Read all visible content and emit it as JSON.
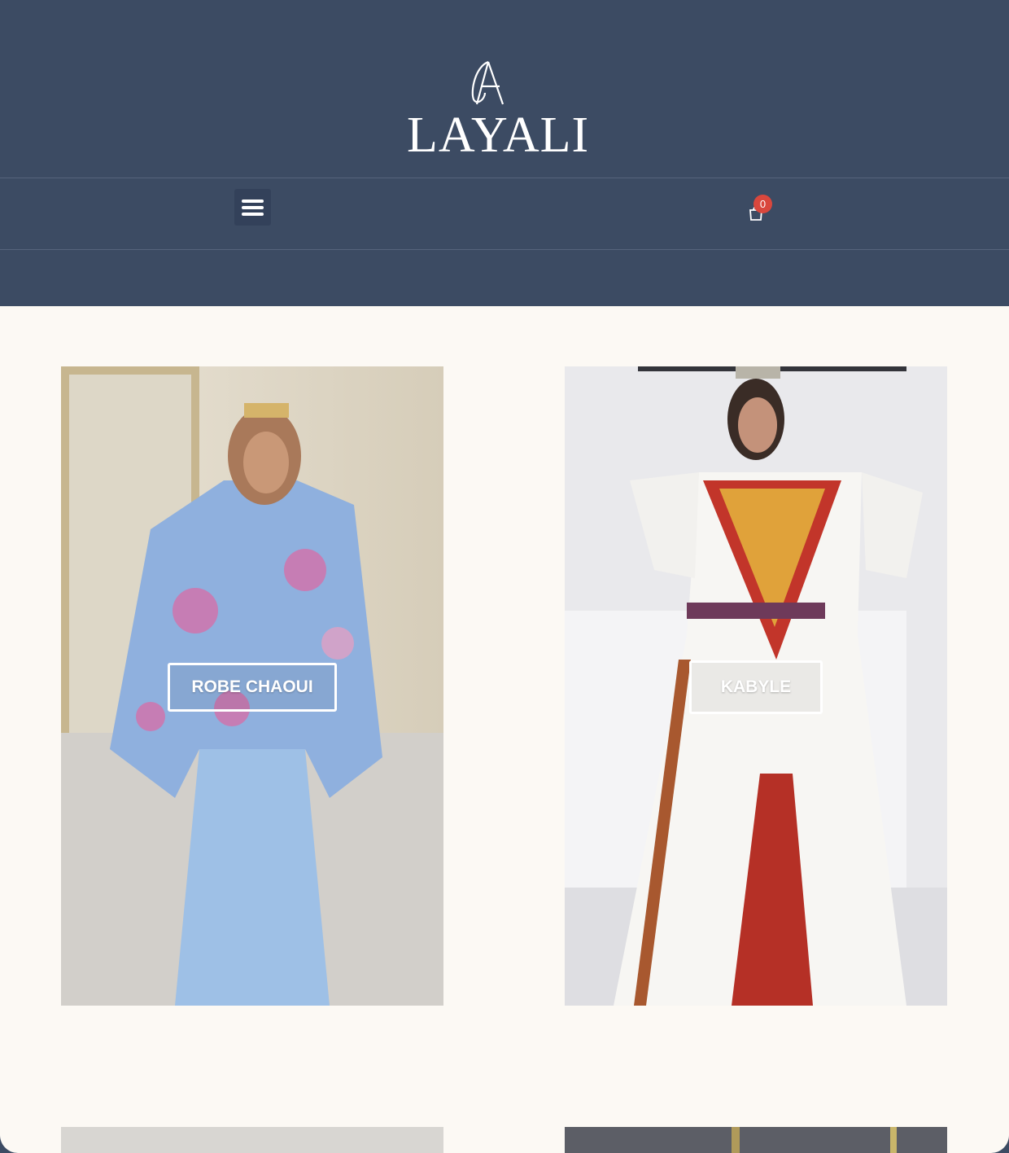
{
  "brand": {
    "name": "LAYALI",
    "colors": {
      "header_bg": "#3c4b63",
      "page_bg": "#fcf9f4",
      "badge": "#d9473d"
    }
  },
  "nav": {
    "menu_icon": "hamburger-menu-icon",
    "cart_icon": "shopping-bag-icon",
    "cart_count": "0"
  },
  "categories": [
    {
      "label": "ROBE CHAOUI",
      "image": "woman-in-blue-floral-cape-dress"
    },
    {
      "label": "KABYLE",
      "image": "woman-in-white-kabyle-dress"
    }
  ],
  "more_categories": [
    {
      "image": "partial-product-image"
    },
    {
      "image": "partial-product-image"
    }
  ]
}
